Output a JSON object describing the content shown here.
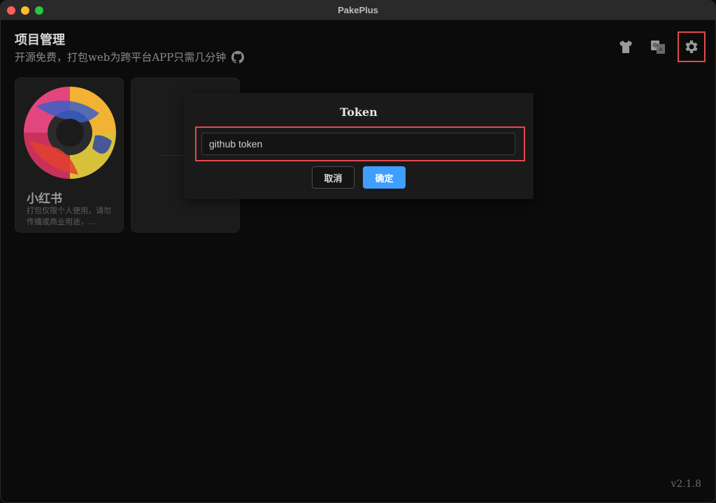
{
  "window": {
    "title": "PakePlus"
  },
  "header": {
    "title": "项目管理",
    "subtitle": "开源免费，打包web为跨平台APP只需几分钟"
  },
  "toolbar": {
    "icons": [
      "tshirt-icon",
      "translate-icon",
      "gear-icon"
    ]
  },
  "projects": [
    {
      "name": "小红书",
      "description": "打包仅限个人使用，请勿传播或商业用途，…"
    }
  ],
  "dialog": {
    "title": "Token",
    "input_value": "github token",
    "cancel_label": "取消",
    "confirm_label": "确定"
  },
  "footer": {
    "version": "v2.1.8"
  },
  "colors": {
    "accent": "#409eff",
    "highlight": "#e5484d"
  }
}
